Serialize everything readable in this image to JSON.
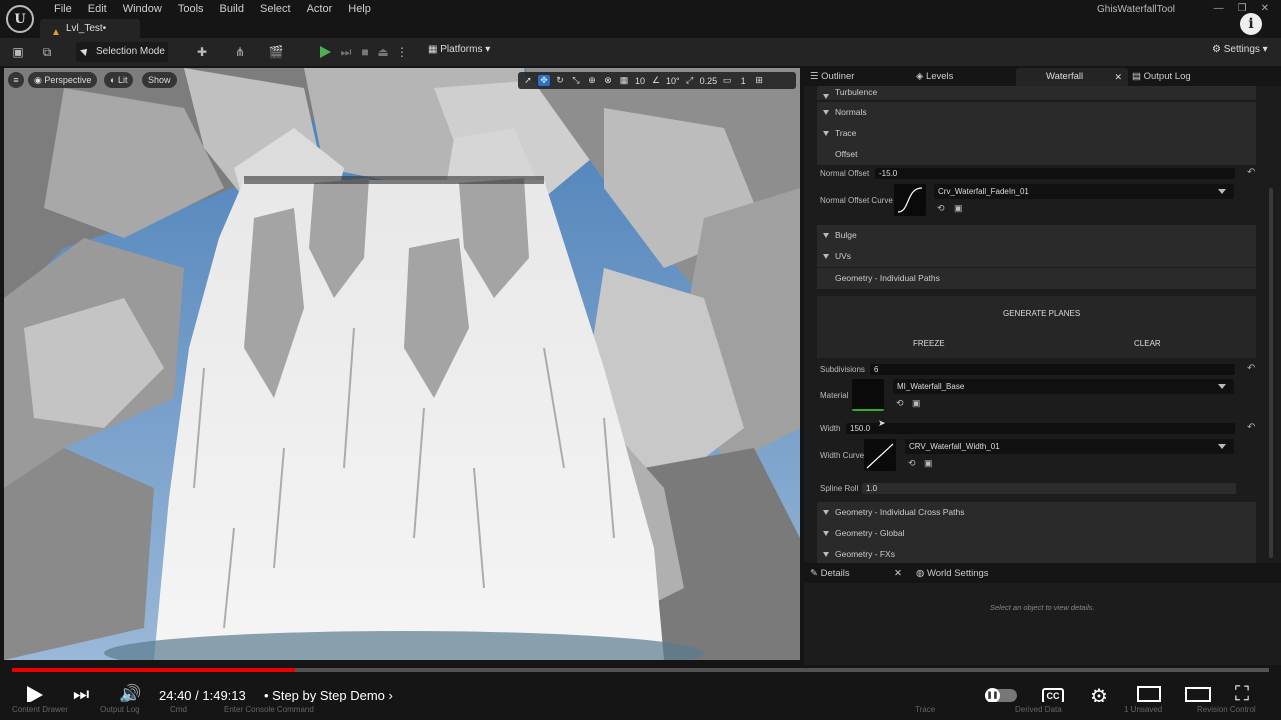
{
  "app": {
    "tab_title": "Lvl_Test•",
    "project_name": "GhisWaterfallTool",
    "logo_glyph": "U"
  },
  "menu": [
    "File",
    "Edit",
    "Window",
    "Tools",
    "Build",
    "Select",
    "Actor",
    "Help"
  ],
  "toolbar": {
    "selection_mode": "Selection Mode",
    "platforms": "Platforms",
    "settings": "Settings"
  },
  "viewport": {
    "perspective": "Perspective",
    "lit": "Lit",
    "show": "Show",
    "grid_size": "10",
    "angle": "10°",
    "scale": "0.25",
    "camera_speed": "1"
  },
  "panel": {
    "tabs": {
      "outliner": "Outliner",
      "levels": "Levels",
      "waterfall": "Waterfall",
      "output_log": "Output Log"
    },
    "sections_top": [
      "Turbulence",
      "Normals",
      "Trace"
    ],
    "offset_label": "Offset",
    "normal_offset": {
      "label": "Normal Offset",
      "value": "-15.0"
    },
    "normal_offset_curve": {
      "label": "Normal Offset Curve",
      "asset": "Crv_Waterfall_FadeIn_01"
    },
    "sections_mid": [
      "Bulge",
      "UVs"
    ],
    "geometry_paths": "Geometry - Individual Paths",
    "generate_planes": "GENERATE PLANES",
    "freeze": "FREEZE",
    "clear": "CLEAR",
    "subdivisions": {
      "label": "Subdivisions",
      "value": "6"
    },
    "material": {
      "label": "Material",
      "asset": "MI_Waterfall_Base"
    },
    "width": {
      "label": "Width",
      "value": "150.0"
    },
    "width_curve": {
      "label": "Width Curve",
      "asset": "CRV_Waterfall_Width_01"
    },
    "spline_roll": {
      "label": "Spline Roll",
      "value": "1.0"
    },
    "sections_bottom": [
      "Geometry - Individual Cross Paths",
      "Geometry - Global",
      "Geometry - FXs"
    ]
  },
  "details": {
    "tab": "Details",
    "world_settings": "World Settings",
    "hint": "Select an object to view details."
  },
  "player": {
    "time": "24:40 / 1:49:13",
    "chapter": "• Step by Step Demo",
    "progress": 0.225,
    "cc_label": "CC"
  },
  "statusbar": {
    "content_drawer": "Content Drawer",
    "output_log": "Output Log",
    "cmd": "Cmd",
    "console_placeholder": "Enter Console Command",
    "trace": "Trace",
    "derived_data": "Derived Data",
    "unsaved": "1 Unsaved",
    "revision_control": "Revision Control"
  }
}
